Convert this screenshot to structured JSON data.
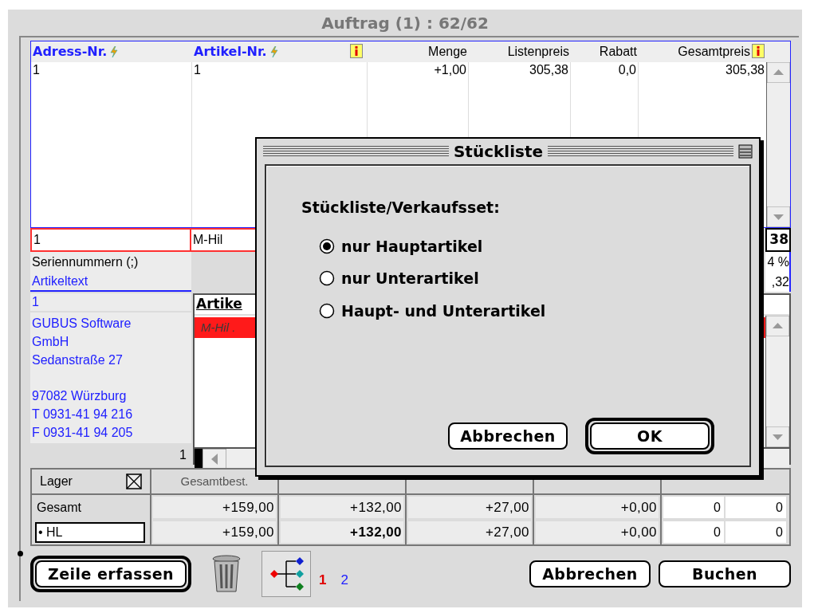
{
  "window": {
    "title": "Auftrag (1) : 62/62"
  },
  "order_table": {
    "columns": [
      {
        "label": "Adress-Nr.",
        "kind": "key",
        "info": false
      },
      {
        "label": "Artikel-Nr.",
        "kind": "key",
        "info": true
      },
      {
        "label": "Menge",
        "kind": "plain",
        "info": false
      },
      {
        "label": "Listenpreis",
        "kind": "plain",
        "info": false
      },
      {
        "label": "Rabatt",
        "kind": "plain",
        "info": false
      },
      {
        "label": "Gesamtpreis",
        "kind": "plain",
        "info": true
      }
    ],
    "rows": [
      [
        "1",
        "1",
        "+1,00",
        "305,38",
        "0,0",
        "305,38"
      ]
    ]
  },
  "edit_row": {
    "address": "1",
    "article": "M-Hil",
    "total": "38"
  },
  "detail_rows": [
    {
      "label": "Seriennummern (;)",
      "kind": "plain",
      "value": "4 %"
    },
    {
      "label": "Artikeltext",
      "kind": "link",
      "value": ",32"
    }
  ],
  "address": {
    "number": "1",
    "blocks": [
      [
        "GUBUS Software",
        "GmbH",
        "Sedanstraße 27"
      ],
      [
        "97082 Würzburg",
        "T 0931-41 94 216",
        "F 0931-41 94 205"
      ]
    ],
    "count": "1"
  },
  "article_list": {
    "header": "Artike",
    "rows": [
      {
        "text": "M-Hil .",
        "selected": true
      }
    ]
  },
  "stock_table": {
    "label": "Lager",
    "checked": true,
    "columns": [
      "Gesamtbest."
    ],
    "rows": [
      {
        "label": "Gesamt",
        "kind": "total",
        "values": [
          {
            "text": "+159,00",
            "bold": false
          },
          {
            "text": "+132,00",
            "bold": false
          },
          {
            "text": "+27,00",
            "bold": false
          },
          {
            "text": "+0,00",
            "bold": false
          }
        ],
        "min": "0",
        "max": "0"
      },
      {
        "label": "• HL",
        "kind": "field",
        "values": [
          {
            "text": "+159,00",
            "bold": false
          },
          {
            "text": "+132,00",
            "bold": true
          },
          {
            "text": "+27,00",
            "bold": false
          },
          {
            "text": "+0,00",
            "bold": false
          }
        ],
        "min": "0",
        "max": "0"
      }
    ]
  },
  "dialog": {
    "title": "Stückliste",
    "prompt": "Stückliste/Verkaufsset:",
    "options": [
      {
        "label": "nur Hauptartikel",
        "selected": true
      },
      {
        "label": "nur Unterartikel",
        "selected": false
      },
      {
        "label": "Haupt- und Unterartikel",
        "selected": false
      }
    ],
    "buttons": [
      {
        "label": "Abbrechen",
        "default": false
      },
      {
        "label": "OK",
        "default": true
      }
    ]
  },
  "footer": {
    "buttons": [
      {
        "label": "Zeile erfassen",
        "default": true
      }
    ],
    "pages": [
      {
        "label": "1",
        "selected": true
      },
      {
        "label": "2",
        "selected": false
      }
    ],
    "actions": [
      {
        "label": "Abbrechen",
        "default": false
      },
      {
        "label": "Buchen",
        "default": false
      }
    ]
  }
}
